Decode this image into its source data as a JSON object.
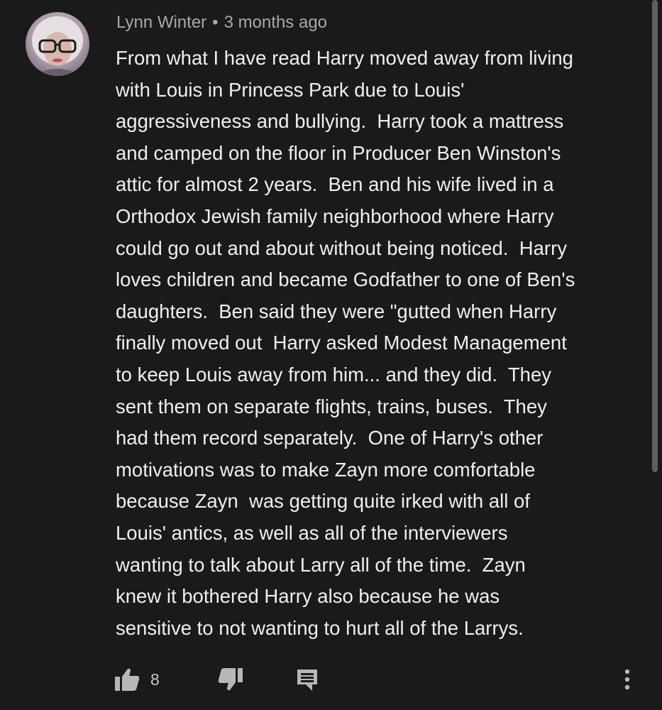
{
  "comment": {
    "author": "Lynn Winter",
    "separator": "•",
    "timestamp": "3 months ago",
    "lines": [
      "From what I have read Harry moved away from living",
      "with Louis in Princess Park due to Louis'",
      "aggressiveness and bullying.  Harry took a mattress",
      "and camped on the floor in Producer Ben Winston's",
      "attic for almost 2 years.  Ben and his wife lived in a",
      "Orthodox Jewish family neighborhood where Harry",
      "could go out and about without being noticed.  Harry",
      "loves children and became Godfather to one of Ben's",
      "daughters.  Ben said they were \"gutted when Harry",
      "finally moved out  Harry asked Modest Management",
      "to keep Louis away from him... and they did.  They",
      "sent them on separate flights, trains, buses.  They",
      "had them record separately.  One of Harry's other",
      "motivations was to make Zayn more comfortable",
      "because Zayn  was getting quite irked with all of",
      "Louis' antics, as well as all of the interviewers",
      "wanting to talk about Larry all of the time.  Zayn",
      "knew it bothered Harry also because he was",
      "sensitive to not wanting to hurt all of the Larrys."
    ],
    "like_count": "8"
  },
  "icons": {
    "avatar": "avatar-photo",
    "like": "thumbs-up-icon",
    "dislike": "thumbs-down-icon",
    "reply": "reply-comment-icon",
    "more": "more-vertical-icon"
  },
  "colors": {
    "background": "#1a1a1a",
    "text": "#efefef",
    "meta_text": "#a9a9a9",
    "icon": "#b8b8b8"
  }
}
